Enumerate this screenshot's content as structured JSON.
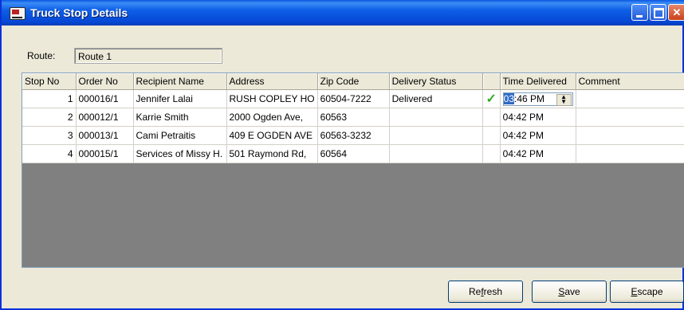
{
  "window": {
    "title": "Truck Stop Details"
  },
  "route": {
    "label": "Route:",
    "value": "Route 1"
  },
  "table": {
    "columns": [
      "Stop No",
      "Order No",
      "Recipient Name",
      "Address",
      "Zip Code",
      "Delivery Status",
      "",
      "Time Delivered",
      "Comment"
    ],
    "rows": [
      {
        "stop": "1",
        "order": "000016/1",
        "recipient": "Jennifer Lalai",
        "address": "RUSH COPLEY HO",
        "zip": "60504-7222",
        "status": "Delivered",
        "check": "✓",
        "time_hl": "03",
        "time_rest": ":46 PM",
        "comment": ""
      },
      {
        "stop": "2",
        "order": "000012/1",
        "recipient": "Karrie Smith",
        "address": "2000 Ogden Ave,",
        "zip": "60563",
        "status": "",
        "check": "",
        "time": "04:42 PM",
        "comment": ""
      },
      {
        "stop": "3",
        "order": "000013/1",
        "recipient": "Cami Petraitis",
        "address": "409 E OGDEN AVE",
        "zip": "60563-3232",
        "status": "",
        "check": "",
        "time": "04:42 PM",
        "comment": ""
      },
      {
        "stop": "4",
        "order": "000015/1",
        "recipient": "Services of Missy H.",
        "address": "501 Raymond Rd,",
        "zip": "60564",
        "status": "",
        "check": "",
        "time": "04:42 PM",
        "comment": ""
      }
    ]
  },
  "buttons": {
    "refresh": {
      "pre": "Re",
      "accel": "f",
      "post": "resh"
    },
    "save": {
      "pre": "",
      "accel": "S",
      "post": "ave"
    },
    "escape": {
      "pre": "",
      "accel": "E",
      "post": "scape"
    }
  },
  "icons": {
    "title": "truck-icon",
    "check": "check-icon",
    "spin": "spinner-icon"
  }
}
